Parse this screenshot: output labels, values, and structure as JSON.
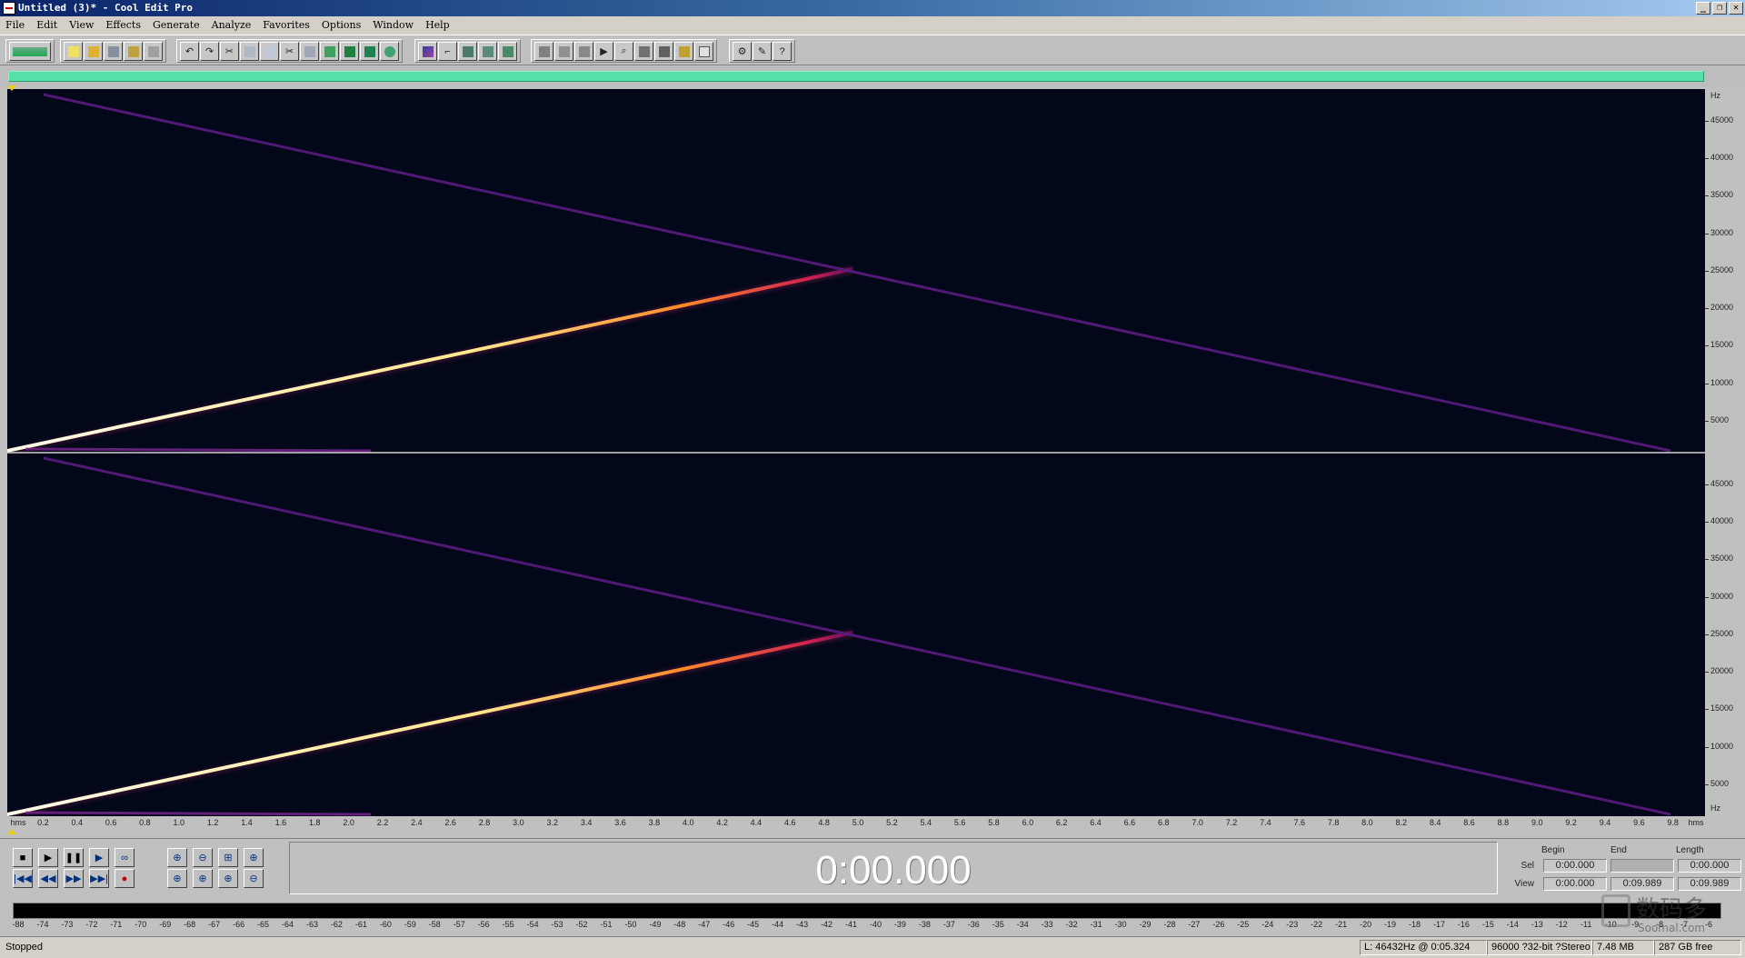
{
  "window": {
    "title": "Untitled (3)* - Cool Edit Pro",
    "controls": [
      "_",
      "❐",
      "✕"
    ]
  },
  "menu": [
    "File",
    "Edit",
    "View",
    "Effects",
    "Generate",
    "Analyze",
    "Favorites",
    "Options",
    "Window",
    "Help"
  ],
  "toolbar": {
    "groups": [
      {
        "name": "mode",
        "buttons": [
          "multitrack-toggle-icon"
        ]
      },
      {
        "name": "file",
        "buttons": [
          "new-icon",
          "open-icon",
          "save-icon",
          "save-as-icon",
          "close-icon"
        ]
      },
      {
        "name": "edit",
        "buttons": [
          "undo-icon",
          "redo-icon",
          "repeat-icon",
          "copy-new-icon",
          "copy-icon",
          "cut-icon",
          "paste-icon",
          "paste-new-icon",
          "mix-paste-icon",
          "trim-icon",
          "convert-icon"
        ]
      },
      {
        "name": "view",
        "buttons": [
          "waveform-view-icon",
          "spectral-view-icon",
          "ruler-icon",
          "grid-icon",
          "metronome-icon"
        ]
      },
      {
        "name": "effects",
        "buttons": [
          "analyze-icon",
          "frequency-icon",
          "cue-icon",
          "play-list-icon",
          "scan-icon",
          "level-icon",
          "time-icon",
          "marker-icon",
          "info-icon"
        ]
      },
      {
        "name": "help",
        "buttons": [
          "settings-icon",
          "script-icon",
          "help-icon"
        ]
      }
    ]
  },
  "spectral": {
    "channels": 2,
    "hz_ruler": {
      "unit": "Hz",
      "labels": [
        "45000",
        "40000",
        "35000",
        "30000",
        "25000",
        "20000",
        "15000",
        "10000",
        "5000"
      ],
      "bottom_unit": "Hz"
    },
    "colors": {
      "background": "#02081a",
      "sweep_hot": "#fff4c0",
      "sweep_warm": "#ff6a20",
      "sweep_cool": "#6a1a8a",
      "separator": "#d0d0d0"
    }
  },
  "time_ruler": {
    "start_unit": "hms",
    "end_unit": "hms",
    "labels": [
      "0.2",
      "0.4",
      "0.6",
      "0.8",
      "1.0",
      "1.2",
      "1.4",
      "1.6",
      "1.8",
      "2.0",
      "2.2",
      "2.4",
      "2.6",
      "2.8",
      "3.0",
      "3.2",
      "3.4",
      "3.6",
      "3.8",
      "4.0",
      "4.2",
      "4.4",
      "4.6",
      "4.8",
      "5.0",
      "5.2",
      "5.4",
      "5.6",
      "5.8",
      "6.0",
      "6.2",
      "6.4",
      "6.6",
      "6.8",
      "7.0",
      "7.2",
      "7.4",
      "7.6",
      "7.8",
      "8.0",
      "8.2",
      "8.4",
      "8.6",
      "8.8",
      "9.0",
      "9.2",
      "9.4",
      "9.6",
      "9.8"
    ]
  },
  "transport": {
    "row1": [
      "■",
      "▶",
      "❚❚",
      "▶",
      "∞"
    ],
    "row2": [
      "|◀◀",
      "◀◀",
      "▶▶",
      "▶▶|",
      "●"
    ],
    "zoom_row1": [
      "⊕",
      "⊖",
      "⊞",
      "⊕"
    ],
    "zoom_row2": [
      "⊕",
      "⊕",
      "⊕",
      "⊖"
    ],
    "time": "0:00.000"
  },
  "selection": {
    "headers": {
      "begin": "Begin",
      "end": "End",
      "length": "Length"
    },
    "sel": {
      "label": "Sel",
      "begin": "0:00.000",
      "end": "",
      "length": "0:00.000"
    },
    "view": {
      "label": "View",
      "begin": "0:00.000",
      "end": "0:09.989",
      "length": "0:09.989"
    }
  },
  "meter": {
    "labels": [
      "-88",
      "-74",
      "-73",
      "-72",
      "-71",
      "-70",
      "-69",
      "-68",
      "-67",
      "-66",
      "-65",
      "-64",
      "-63",
      "-62",
      "-61",
      "-60",
      "-59",
      "-58",
      "-57",
      "-56",
      "-55",
      "-54",
      "-53",
      "-52",
      "-51",
      "-50",
      "-49",
      "-48",
      "-47",
      "-46",
      "-45",
      "-44",
      "-43",
      "-42",
      "-41",
      "-40",
      "-39",
      "-38",
      "-37",
      "-36",
      "-35",
      "-34",
      "-33",
      "-32",
      "-31",
      "-30",
      "-29",
      "-28",
      "-27",
      "-26",
      "-25",
      "-24",
      "-23",
      "-22",
      "-21",
      "-20",
      "-19",
      "-18",
      "-17",
      "-16",
      "-15",
      "-14",
      "-13",
      "-12",
      "-11",
      "-10",
      "-9",
      "-8",
      "-7",
      "-6"
    ]
  },
  "status": {
    "state": "Stopped",
    "cursor": "L: 46432Hz @   0:05.324",
    "format": "96000 ?32-bit ?Stereo",
    "size": "7.48 MB",
    "free": "287 GB free"
  },
  "watermark": {
    "cn": "数码多",
    "url": "Soomal.com"
  }
}
